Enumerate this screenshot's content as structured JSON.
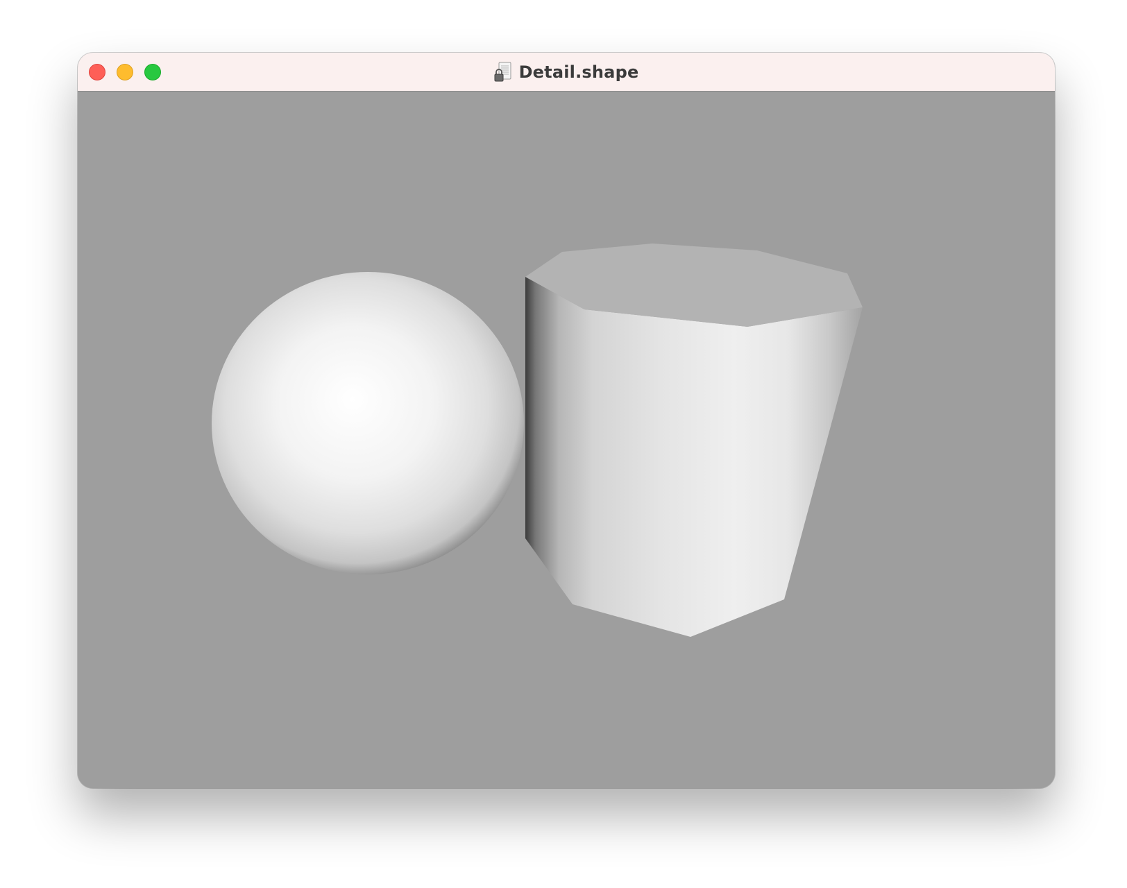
{
  "window": {
    "title": "Detail.shape",
    "title_icon": "locked-document-icon"
  },
  "traffic_lights": {
    "close_icon": "close-icon",
    "minimize_icon": "minimize-icon",
    "zoom_icon": "zoom-icon"
  },
  "scene": {
    "background_color": "#9e9e9e",
    "objects": [
      {
        "type": "sphere",
        "name": "sphere"
      },
      {
        "type": "cylinder",
        "name": "cylinder"
      }
    ]
  }
}
